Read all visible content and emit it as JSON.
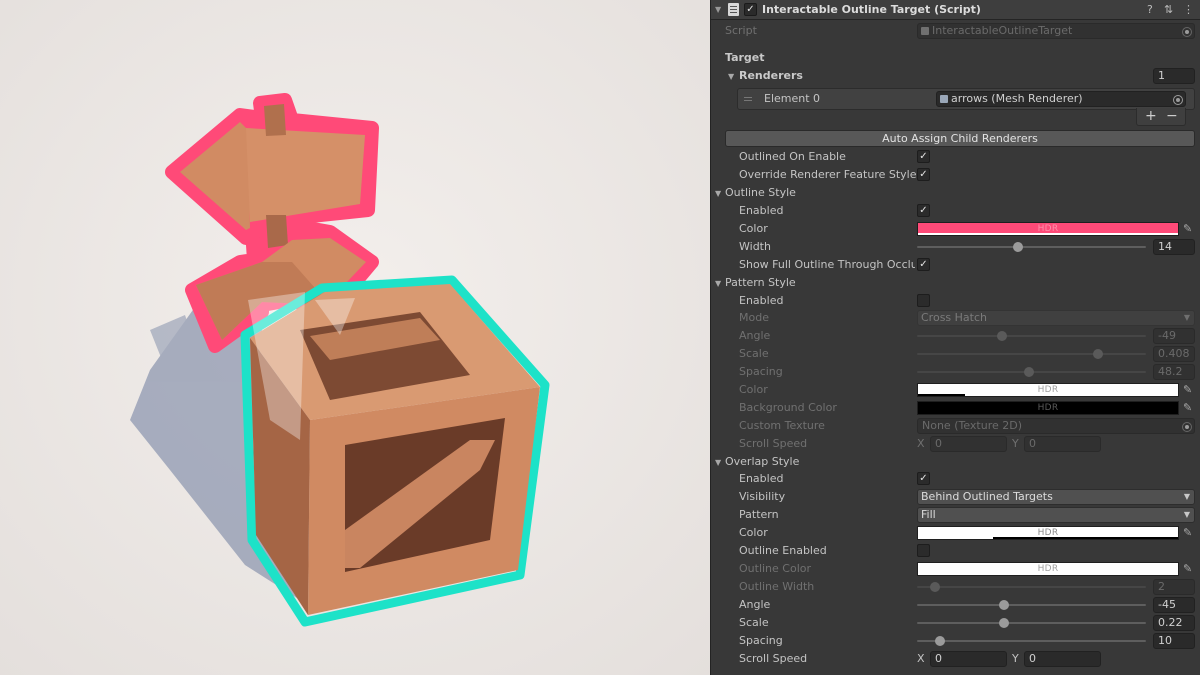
{
  "component": {
    "title": "Interactable Outline Target (Script)",
    "help_icon": "help-icon",
    "preset_icon": "preset-icon",
    "menu_icon": "kebab-menu-icon",
    "enabled": true
  },
  "script": {
    "label": "Script",
    "value": "InteractableOutlineTarget"
  },
  "target": {
    "label": "Target",
    "renderers_label": "Renderers",
    "renderers_count": "1",
    "element_label": "Element 0",
    "element_value": "arrows (Mesh Renderer)",
    "add_label": "+",
    "remove_label": "−",
    "auto_assign_label": "Auto Assign Child Renderers",
    "outlined_on_enable_label": "Outlined On Enable",
    "override_label": "Override Renderer Feature Style"
  },
  "outline_style": {
    "label": "Outline Style",
    "enabled_label": "Enabled",
    "color_label": "Color",
    "color_value": "#ff4a78",
    "color_hdr": "HDR",
    "width_label": "Width",
    "width_value": "14",
    "width_fraction": 0.44,
    "show_full_label": "Show Full Outline Through Occluders"
  },
  "pattern_style": {
    "label": "Pattern Style",
    "enabled_label": "Enabled",
    "mode_label": "Mode",
    "mode_value": "Cross Hatch",
    "angle_label": "Angle",
    "angle_value": "-49",
    "angle_fraction": 0.37,
    "scale_label": "Scale",
    "scale_value": "0.408",
    "scale_fraction": 0.79,
    "spacing_label": "Spacing",
    "spacing_value": "48.2",
    "spacing_fraction": 0.49,
    "color_label": "Color",
    "color_hdr": "HDR",
    "background_color_label": "Background Color",
    "background_hdr": "HDR",
    "custom_texture_label": "Custom Texture",
    "custom_texture_value": "None (Texture 2D)",
    "scroll_speed_label": "Scroll Speed",
    "x_label": "X",
    "x_value": "0",
    "y_label": "Y",
    "y_value": "0"
  },
  "overlap_style": {
    "label": "Overlap Style",
    "enabled_label": "Enabled",
    "visibility_label": "Visibility",
    "visibility_value": "Behind Outlined Targets",
    "pattern_label": "Pattern",
    "pattern_value": "Fill",
    "color_label": "Color",
    "color_hdr": "HDR",
    "outline_enabled_label": "Outline Enabled",
    "outline_color_label": "Outline Color",
    "outline_color_hdr": "HDR",
    "outline_width_label": "Outline Width",
    "outline_width_value": "2",
    "outline_width_fraction": 0.08,
    "angle_label": "Angle",
    "angle_value": "-45",
    "angle_fraction": 0.38,
    "scale_label": "Scale",
    "scale_value": "0.22",
    "scale_fraction": 0.38,
    "spacing_label": "Spacing",
    "spacing_value": "10",
    "spacing_fraction": 0.1,
    "scroll_speed_label": "Scroll Speed",
    "x_label": "X",
    "x_value": "0",
    "y_label": "Y",
    "y_value": "0"
  },
  "colors": {
    "outline_pink": "#ff4a78",
    "outline_teal": "#1de2c8",
    "crate_wood": "#d08a62"
  }
}
